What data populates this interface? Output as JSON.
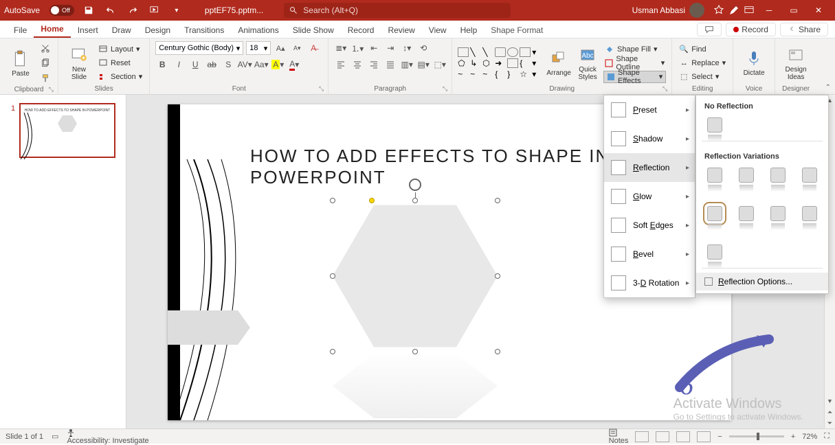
{
  "titlebar": {
    "autosave_label": "AutoSave",
    "autosave_state": "Off",
    "filename": "pptEF75.pptm...",
    "search_placeholder": "Search (Alt+Q)",
    "username": "Usman Abbasi"
  },
  "tabs": {
    "file": "File",
    "home": "Home",
    "insert": "Insert",
    "draw": "Draw",
    "design": "Design",
    "transitions": "Transitions",
    "animations": "Animations",
    "slideshow": "Slide Show",
    "record": "Record",
    "review": "Review",
    "view": "View",
    "help": "Help",
    "shape_format": "Shape Format",
    "record_btn": "Record",
    "share_btn": "Share"
  },
  "ribbon": {
    "paste": "Paste",
    "clipboard": "Clipboard",
    "new_slide": "New\nSlide",
    "layout": "Layout",
    "reset": "Reset",
    "section": "Section",
    "slides": "Slides",
    "font_name": "Century Gothic (Body)",
    "font_size": "18",
    "font": "Font",
    "paragraph": "Paragraph",
    "arrange": "Arrange",
    "quick_styles": "Quick\nStyles",
    "shape_fill": "Shape Fill",
    "shape_outline": "Shape Outline",
    "shape_effects": "Shape Effects",
    "drawing": "Drawing",
    "find": "Find",
    "replace": "Replace",
    "select": "Select",
    "editing": "Editing",
    "dictate": "Dictate",
    "voice": "Voice",
    "design_ideas": "Design\nIdeas",
    "designer": "Designer"
  },
  "fx_menu": {
    "preset": "Preset",
    "shadow": "Shadow",
    "reflection": "Reflection",
    "glow": "Glow",
    "soft_edges": "Soft Edges",
    "bevel": "Bevel",
    "rotation": "3-D Rotation"
  },
  "reflect": {
    "no_reflection": "No Reflection",
    "variations": "Reflection Variations",
    "options": "Reflection Options..."
  },
  "slide": {
    "title": "HOW TO ADD EFFECTS TO SHAPE IN POWERPOINT",
    "step": "6"
  },
  "thumbs": {
    "num1": "1",
    "mini_title": "HOW TO ADD EFFECTS TO SHAPE IN POWERPOINT"
  },
  "activate": {
    "line1": "Activate Windows",
    "line2": "Go to Settings to activate Windows."
  },
  "status": {
    "slide_info": "Slide 1 of 1",
    "accessibility": "Accessibility: Investigate",
    "notes": "Notes",
    "zoom": "72%"
  }
}
